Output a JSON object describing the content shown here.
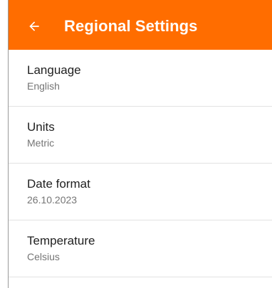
{
  "app_bar": {
    "title": "Regional Settings",
    "back_icon": "arrow-left-icon",
    "color": "#ff6d00"
  },
  "settings": [
    {
      "title": "Language",
      "value": "English"
    },
    {
      "title": "Units",
      "value": "Metric"
    },
    {
      "title": "Date format",
      "value": "26.10.2023"
    },
    {
      "title": "Temperature",
      "value": "Celsius"
    }
  ]
}
